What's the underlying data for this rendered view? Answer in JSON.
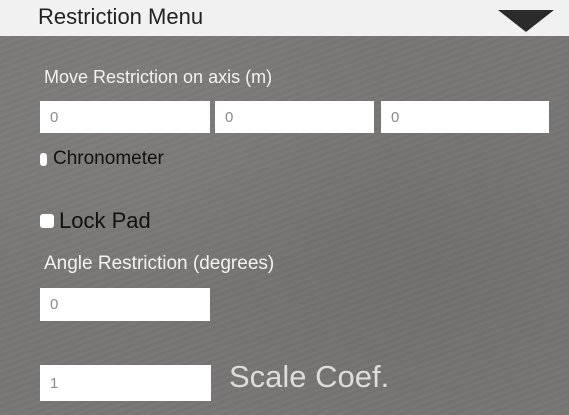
{
  "header": {
    "title": "Restriction Menu",
    "toggle_icon": "triangle-down-icon"
  },
  "move_restriction": {
    "label": "Move Restriction on axis (m)",
    "x_value": "0",
    "y_value": "0",
    "z_value": "0"
  },
  "chronometer": {
    "label": "Chronometer",
    "checked": false
  },
  "lock_pad": {
    "label": "Lock Pad",
    "checked": false
  },
  "angle_restriction": {
    "label": "Angle Restriction (degrees)",
    "value": "0"
  },
  "scale": {
    "value": "1",
    "label": "Scale Coef."
  },
  "colors": {
    "header_bg": "#f1f1f1",
    "panel_bg": "#777674",
    "label_text": "#f2f2f2",
    "field_bg": "#ffffff",
    "field_text": "#8a8a8a",
    "toggle_icon": "#2b2b2b"
  }
}
